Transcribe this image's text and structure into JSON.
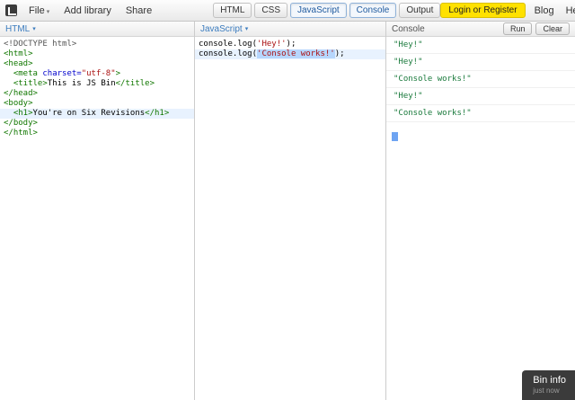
{
  "colors": {
    "tag": "#117700",
    "attr": "#0000cc",
    "string": "#aa1111",
    "meta": "#555555",
    "plain": "#000000",
    "console_text": "#1a7a3c",
    "active_line_bg": "#e8f2fe",
    "selection_bg": "#b6d6fd",
    "login_bg": "#ffe100",
    "panel_label": "#3d7dbf"
  },
  "toolbar": {
    "file_label": "File",
    "add_library_label": "Add library",
    "share_label": "Share",
    "panel_toggles": [
      {
        "label": "HTML",
        "active": false
      },
      {
        "label": "CSS",
        "active": false
      },
      {
        "label": "JavaScript",
        "active": true
      },
      {
        "label": "Console",
        "active": true
      },
      {
        "label": "Output",
        "active": false
      }
    ],
    "login_label": "Login or Register",
    "blog_label": "Blog",
    "help_label": "Help"
  },
  "html_panel": {
    "label": "HTML",
    "lines": [
      {
        "tokens": [
          {
            "c": "meta",
            "t": "<!DOCTYPE html>"
          }
        ]
      },
      {
        "tokens": [
          {
            "c": "tag",
            "t": "<html>"
          }
        ]
      },
      {
        "tokens": [
          {
            "c": "tag",
            "t": "<head>"
          }
        ]
      },
      {
        "tokens": [
          {
            "c": "plain",
            "t": "  "
          },
          {
            "c": "tag",
            "t": "<meta "
          },
          {
            "c": "attr",
            "t": "charset="
          },
          {
            "c": "string",
            "t": "\"utf-8\""
          },
          {
            "c": "tag",
            "t": ">"
          }
        ]
      },
      {
        "tokens": [
          {
            "c": "plain",
            "t": "  "
          },
          {
            "c": "tag",
            "t": "<title>"
          },
          {
            "c": "plain",
            "t": "This is JS Bin"
          },
          {
            "c": "tag",
            "t": "</title>"
          }
        ]
      },
      {
        "tokens": [
          {
            "c": "tag",
            "t": "</head>"
          }
        ]
      },
      {
        "tokens": [
          {
            "c": "tag",
            "t": "<body>"
          }
        ]
      },
      {
        "active": true,
        "tokens": [
          {
            "c": "plain",
            "t": "  "
          },
          {
            "c": "tag",
            "t": "<h1>"
          },
          {
            "c": "plain",
            "t": "You're on Six Revisions"
          },
          {
            "c": "tag",
            "t": "</h1>"
          }
        ]
      },
      {
        "tokens": [
          {
            "c": "tag",
            "t": "</body>"
          }
        ]
      },
      {
        "tokens": [
          {
            "c": "tag",
            "t": "</html>"
          }
        ]
      }
    ]
  },
  "js_panel": {
    "label": "JavaScript",
    "lines": [
      {
        "tokens": [
          {
            "c": "plain",
            "t": "console.log("
          },
          {
            "c": "string",
            "t": "'Hey!'"
          },
          {
            "c": "plain",
            "t": ");"
          }
        ]
      },
      {
        "active": true,
        "tokens": [
          {
            "c": "plain",
            "t": "console.log("
          },
          {
            "c": "string",
            "s": true,
            "t": "'Console works!'"
          },
          {
            "c": "plain",
            "t": ");"
          }
        ]
      }
    ]
  },
  "console_panel": {
    "label": "Console",
    "run_label": "Run",
    "clear_label": "Clear",
    "entries": [
      "\"Hey!\"",
      "\"Hey!\"",
      "\"Console works!\"",
      "\"Hey!\"",
      "\"Console works!\""
    ]
  },
  "bin_info": {
    "title": "Bin info",
    "time": "just now"
  }
}
